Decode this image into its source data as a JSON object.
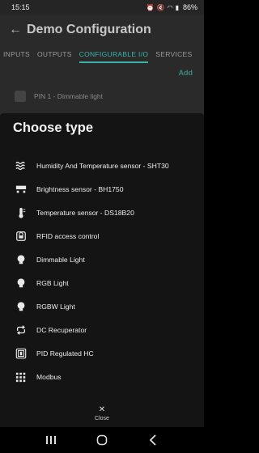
{
  "status_bar": {
    "time": "15:15",
    "battery": "86%"
  },
  "app_bar": {
    "title": "Demo Configuration"
  },
  "tabs": [
    {
      "label": "INPUTS"
    },
    {
      "label": "OUTPUTS"
    },
    {
      "label": "CONFIGURABLE I/O"
    },
    {
      "label": "SERVICES"
    }
  ],
  "add_label": "Add",
  "background_pin": "PIN 1 - Dimmable light",
  "sheet": {
    "title": "Choose type",
    "close_label": "Close",
    "items": [
      {
        "label": "Humidity And Temperature sensor - SHT30",
        "icon": "humidity-icon"
      },
      {
        "label": "Brightness sensor - BH1750",
        "icon": "brightness-sensor-icon"
      },
      {
        "label": "Temperature sensor - DS18B20",
        "icon": "thermometer-icon"
      },
      {
        "label": "RFID access control",
        "icon": "rfid-icon"
      },
      {
        "label": "Dimmable Light",
        "icon": "bulb-icon"
      },
      {
        "label": "RGB Light",
        "icon": "bulb-icon"
      },
      {
        "label": "RGBW Light",
        "icon": "bulb-icon"
      },
      {
        "label": "DC Recuperator",
        "icon": "repeat-icon"
      },
      {
        "label": "PID Regulated HC",
        "icon": "pid-icon"
      },
      {
        "label": "Modbus",
        "icon": "modbus-icon"
      }
    ]
  }
}
